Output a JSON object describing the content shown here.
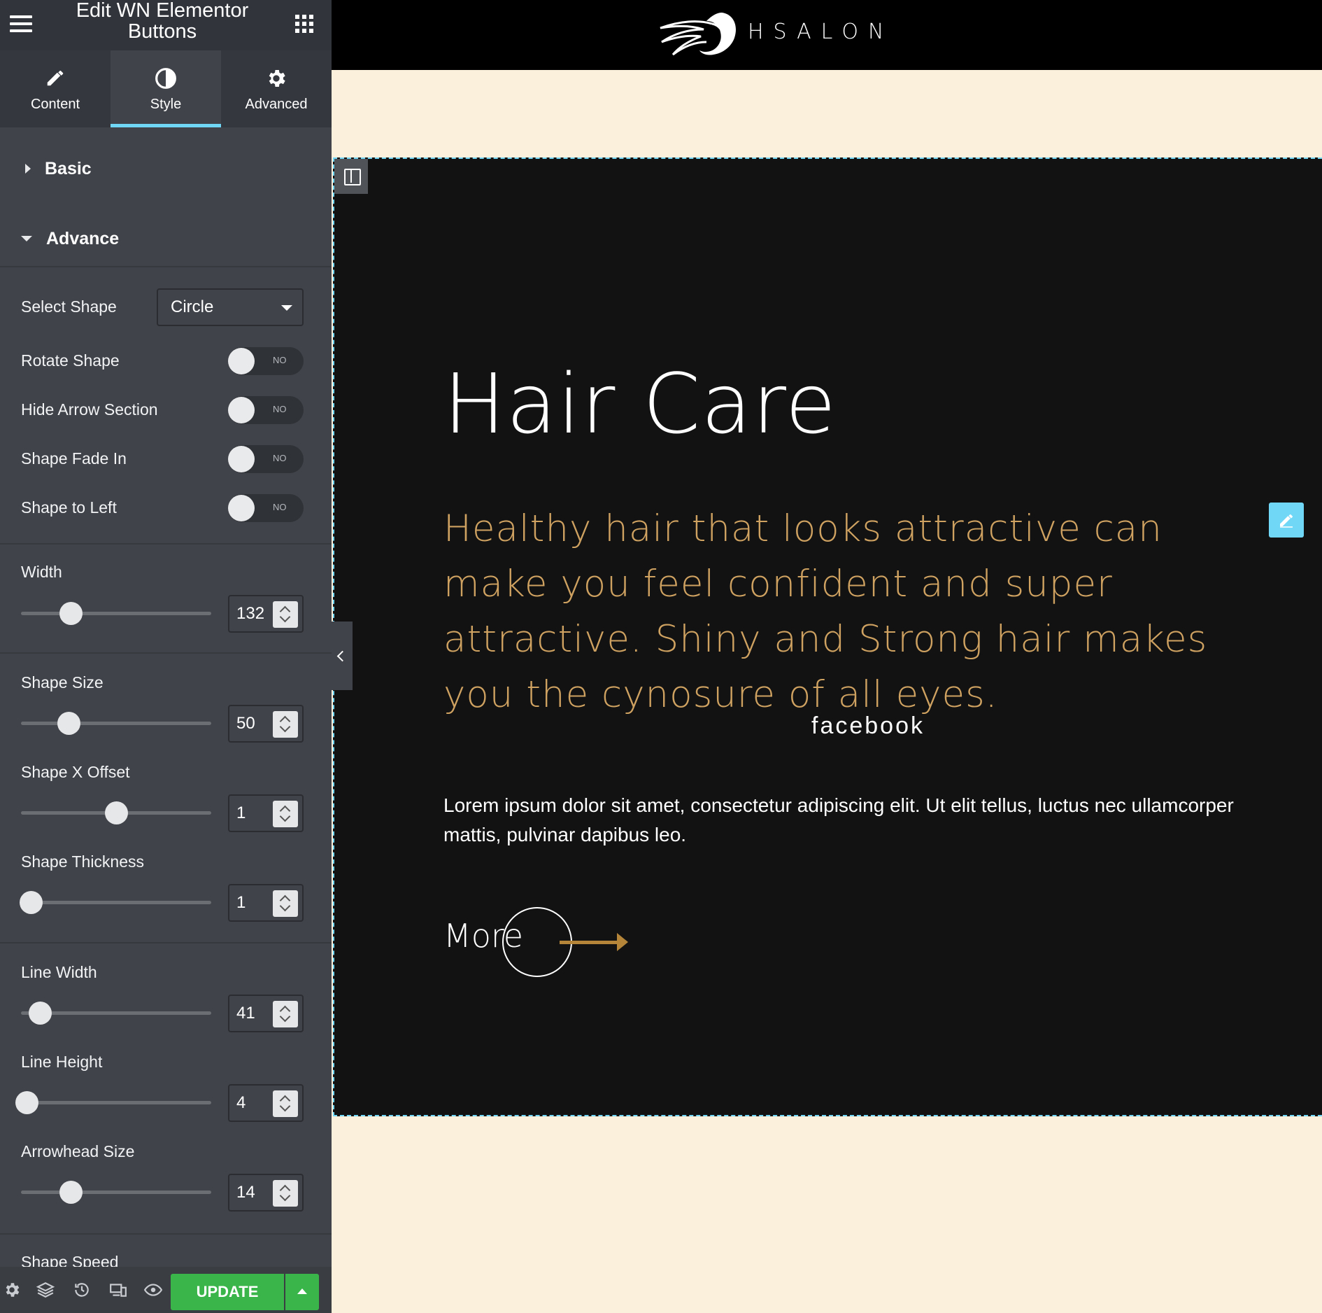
{
  "panel": {
    "title": "Edit WN Elementor Buttons",
    "tabs": [
      {
        "label": "Content",
        "icon": "pencil-icon"
      },
      {
        "label": "Style",
        "icon": "contrast-icon"
      },
      {
        "label": "Advanced",
        "icon": "gear-icon"
      }
    ],
    "sections": {
      "basic": "Basic",
      "advance": "Advance",
      "cut_off": "Shape Speed"
    },
    "select_shape": {
      "label": "Select Shape",
      "value": "Circle"
    },
    "toggles": [
      {
        "label": "Rotate Shape",
        "state": "NO"
      },
      {
        "label": "Hide Arrow Section",
        "state": "NO"
      },
      {
        "label": "Shape Fade In",
        "state": "NO"
      },
      {
        "label": "Shape to Left",
        "state": "NO"
      }
    ],
    "sliders": [
      {
        "label": "Width",
        "value": "132",
        "fraction": 0.26
      },
      {
        "label": "Shape Size",
        "value": "50",
        "fraction": 0.25
      },
      {
        "label": "Shape X Offset",
        "value": "1",
        "fraction": 0.5
      },
      {
        "label": "Shape Thickness",
        "value": "1",
        "fraction": 0.05
      },
      {
        "label": "Line Width",
        "value": "41",
        "fraction": 0.1
      },
      {
        "label": "Line Height",
        "value": "4",
        "fraction": 0.03
      },
      {
        "label": "Arrowhead Size",
        "value": "14",
        "fraction": 0.26
      }
    ],
    "footer": {
      "update_label": "UPDATE"
    }
  },
  "site": {
    "brand": "HSALON"
  },
  "content": {
    "title": "Hair Care",
    "lead": "Healthy hair that looks attractive can make you feel confident and super attractive. Shiny and Strong hair makes you the cynosure of all eyes.",
    "social": "facebook",
    "body": "Lorem ipsum dolor sit amet, consectetur adipiscing elit. Ut elit tellus, luctus nec ullamcorper mattis, pulvinar dapibus leo.",
    "button_label": "More"
  },
  "colors": {
    "accent": "#71d7f7",
    "gold": "#cfa261",
    "update_green": "#39b54a",
    "cream": "#fbf0dc"
  }
}
